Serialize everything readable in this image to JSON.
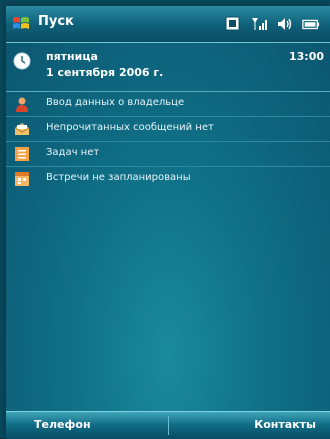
{
  "titlebar": {
    "start_label": "Пуск",
    "tray_icons": [
      "connectivity-icon",
      "signal-icon",
      "volume-icon",
      "battery-icon"
    ]
  },
  "today": {
    "weekday": "пятница",
    "date": "1 сентября 2006 г.",
    "time": "13:00",
    "items": [
      {
        "icon": "owner-icon",
        "label": "Ввод данных о владельце"
      },
      {
        "icon": "mail-icon",
        "label": "Непрочитанных сообщений нет"
      },
      {
        "icon": "tasks-icon",
        "label": "Задач нет"
      },
      {
        "icon": "calendar-icon",
        "label": "Встречи не запланированы"
      }
    ]
  },
  "softkeys": {
    "left": "Телефон",
    "right": "Контакты"
  },
  "colors": {
    "accent": "#0f6f86",
    "titlebar": "#2a8aa3",
    "text": "#ffffff"
  }
}
